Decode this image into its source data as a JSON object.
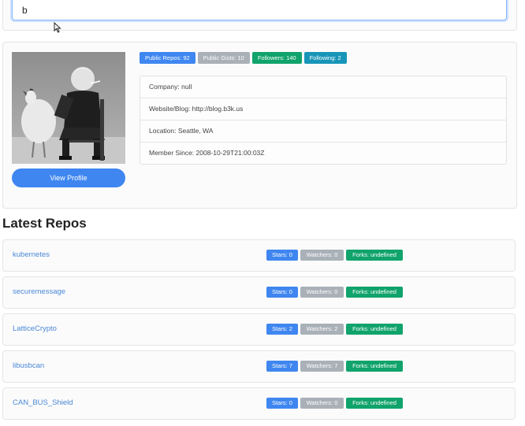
{
  "search": {
    "value": "b"
  },
  "profile": {
    "badges": [
      {
        "label": "Public Repos: 92",
        "color": "#3f86f0"
      },
      {
        "label": "Public Gists: 10",
        "color": "#a9b0b8"
      },
      {
        "label": "Followers: 140",
        "color": "#10a36b"
      },
      {
        "label": "Following: 2",
        "color": "#1795b8"
      }
    ],
    "info": [
      "Company: null",
      "Website/Blog: http://blog.b3k.us",
      "Location: Seattle, WA",
      "Member Since: 2008-10-29T21:00:03Z"
    ],
    "view_profile_label": "View Profile"
  },
  "repos_section": {
    "title": "Latest Repos",
    "repos": [
      {
        "name": "kubernetes",
        "stars": "Stars: 0",
        "watchers": "Watchers: 0",
        "forks": "Forks: undefined"
      },
      {
        "name": "securemessage",
        "stars": "Stars: 0",
        "watchers": "Watchers: 0",
        "forks": "Forks: undefined"
      },
      {
        "name": "LatticeCrypto",
        "stars": "Stars: 2",
        "watchers": "Watchers: 2",
        "forks": "Forks: undefined"
      },
      {
        "name": "libusbcan",
        "stars": "Stars: 7",
        "watchers": "Watchers: 7",
        "forks": "Forks: undefined"
      },
      {
        "name": "CAN_BUS_Shield",
        "stars": "Stars: 0",
        "watchers": "Watchers: 0",
        "forks": "Forks: undefined"
      }
    ]
  },
  "colors": {
    "accent": "#3f86f0",
    "link": "#4a88d8",
    "gray": "#a9b0b8",
    "green": "#10a36b",
    "teal": "#1795b8"
  }
}
